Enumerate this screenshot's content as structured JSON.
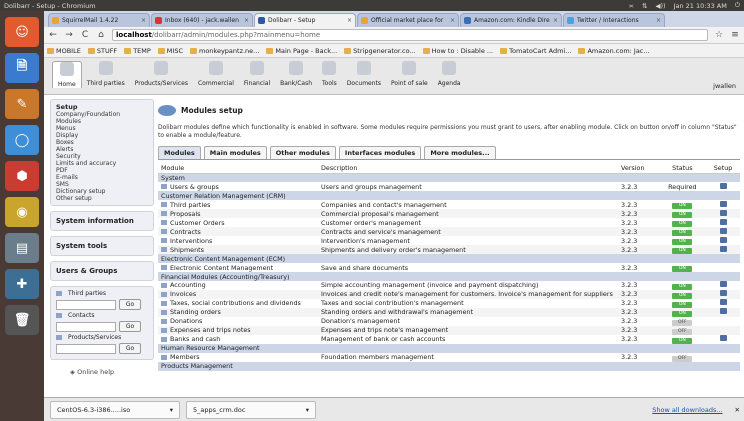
{
  "os": {
    "title": "Dolibarr - Setup - Chromium",
    "tray": [
      "≍",
      "⇅",
      "◀))",
      "Jan 21 10:33 AM",
      "⏻"
    ]
  },
  "launcher": [
    "☺",
    "🗎",
    "✎",
    "◯",
    "⬢",
    "◉",
    "▤",
    "✚",
    "🗑"
  ],
  "tabs": [
    {
      "label": "SquirrelMail 1.4.22",
      "color": "#e7a33e"
    },
    {
      "label": "Inbox (640) - jack.wallen",
      "color": "#d33"
    },
    {
      "label": "Dolibarr - Setup",
      "color": "#2a5aa7"
    },
    {
      "label": "Official market place for",
      "color": "#e7a33e"
    },
    {
      "label": "Amazon.com: Kindle Dire",
      "color": "#3b6fb5"
    },
    {
      "label": "Twitter / Interactions",
      "color": "#4aa3df"
    }
  ],
  "url": {
    "host": "localhost",
    "path": "/dolibarr/admin/modules.php?mainmenu=home"
  },
  "bookmarks": [
    "MOBILE",
    "STUFF",
    "TEMP",
    "MISC",
    "monkeypantz.ne...",
    "Main Page - Back...",
    "Stripgenerator.co...",
    "How to : Disable ...",
    "TomatoCart Admi...",
    "Amazon.com: Jac..."
  ],
  "menu": [
    "Home",
    "Third parties",
    "Products/Services",
    "Commercial",
    "Financial",
    "Bank/Cash",
    "Tools",
    "Documents",
    "Point of sale",
    "Agenda"
  ],
  "user": "jwallen",
  "left": {
    "setup_title": "Setup",
    "setup_items": [
      "Company/Foundation",
      "Modules",
      "Menus",
      "Display",
      "Boxes",
      "Alerts",
      "Security",
      "Limits and accuracy",
      "PDF",
      "E-mails",
      "SMS",
      "Dictionary setup",
      "Other setup"
    ],
    "system_info": "System information",
    "system_tools": "System tools",
    "users_groups": "Users & Groups",
    "search": [
      {
        "label": "Third parties",
        "go": "Go"
      },
      {
        "label": "Contacts",
        "go": "Go"
      },
      {
        "label": "Products/Services",
        "go": "Go"
      }
    ],
    "online_help": "Online help"
  },
  "content": {
    "title": "Modules setup",
    "desc": "Dolibarr modules define which functionality is enabled in software. Some modules require permissions you must grant to users, after enabling module. Click on button on/off in column \"Status\" to enable a module/feature.",
    "tabs": [
      "Modules",
      "Main modules",
      "Other modules",
      "Interfaces modules",
      "More modules..."
    ],
    "headers": [
      "Module",
      "Description",
      "Version",
      "Status",
      "Setup"
    ],
    "rows": [
      {
        "g": "System"
      },
      {
        "m": "Users & groups",
        "d": "Users and groups management",
        "v": "3.2.3",
        "s": "Required",
        "c": true
      },
      {
        "g": "Customer Relation Management (CRM)"
      },
      {
        "m": "Third parties",
        "d": "Companies and contact's management",
        "v": "3.2.3",
        "s": "ON",
        "c": true
      },
      {
        "m": "Proposals",
        "d": "Commercial proposal's management",
        "v": "3.2.3",
        "s": "ON",
        "c": true
      },
      {
        "m": "Customer Orders",
        "d": "Customer order's management",
        "v": "3.2.3",
        "s": "ON",
        "c": true
      },
      {
        "m": "Contracts",
        "d": "Contracts and service's management",
        "v": "3.2.3",
        "s": "ON",
        "c": true
      },
      {
        "m": "Interventions",
        "d": "Intervention's management",
        "v": "3.2.3",
        "s": "ON",
        "c": true
      },
      {
        "m": "Shipments",
        "d": "Shipments and delivery order's management",
        "v": "3.2.3",
        "s": "ON",
        "c": true
      },
      {
        "g": "Electronic Content Management (ECM)"
      },
      {
        "m": "Electronic Content Management",
        "d": "Save and share documents",
        "v": "3.2.3",
        "s": "ON",
        "c": false
      },
      {
        "g": "Financial Modules (Accounting/Treasury)"
      },
      {
        "m": "Accounting",
        "d": "Simple accounting management (invoice and payment dispatching)",
        "v": "3.2.3",
        "s": "ON",
        "c": true
      },
      {
        "m": "Invoices",
        "d": "Invoices and credit note's management for customers. Invoice's management for suppliers",
        "v": "3.2.3",
        "s": "ON",
        "c": true
      },
      {
        "m": "Taxes, social contributions and dividends",
        "d": "Taxes and social contribution's management",
        "v": "3.2.3",
        "s": "ON",
        "c": true
      },
      {
        "m": "Standing orders",
        "d": "Standing orders and withdrawal's management",
        "v": "3.2.3",
        "s": "ON",
        "c": true
      },
      {
        "m": "Donations",
        "d": "Donation's management",
        "v": "3.2.3",
        "s": "OFF",
        "c": false
      },
      {
        "m": "Expenses and trips notes",
        "d": "Expenses and trips note's management",
        "v": "3.2.3",
        "s": "OFF",
        "c": false
      },
      {
        "m": "Banks and cash",
        "d": "Management of bank or cash accounts",
        "v": "3.2.3",
        "s": "ON",
        "c": true
      },
      {
        "g": "Human Resource Management"
      },
      {
        "m": "Members",
        "d": "Foundation members management",
        "v": "3.2.3",
        "s": "OFF",
        "c": false
      },
      {
        "g": "Products Management"
      }
    ]
  },
  "downloads": [
    {
      "name": "CentOS-6.3-i386.....iso"
    },
    {
      "name": "5_apps_crm.doc"
    }
  ],
  "show_all": "Show all downloads...",
  "colors": {
    "accent": "#2a5aa7",
    "on": "#52b34c",
    "group": "#cdd6e6"
  }
}
